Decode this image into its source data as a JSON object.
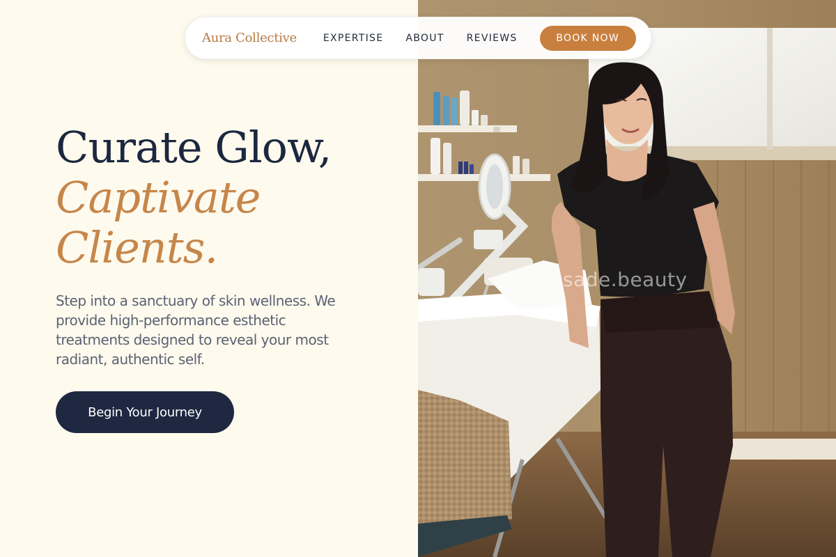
{
  "nav": {
    "brand": "Aura Collective",
    "links": [
      "EXPERTISE",
      "ABOUT",
      "REVIEWS"
    ],
    "book_label": "BOOK NOW"
  },
  "hero": {
    "headline_line1": "Curate Glow,",
    "headline_line2": "Captivate",
    "headline_line3": "Clients.",
    "intro": "Step into a sanctuary of skin wellness. We provide high-performance esthetic treatments designed to reveal your most radiant, authentic self.",
    "cta_label": "Begin Your Journey"
  },
  "photo": {
    "watermark": "sade.beauty"
  },
  "colors": {
    "background": "#fefaee",
    "navy": "#1e2840",
    "accent": "#c6864a",
    "book_button": "#c9803f"
  }
}
